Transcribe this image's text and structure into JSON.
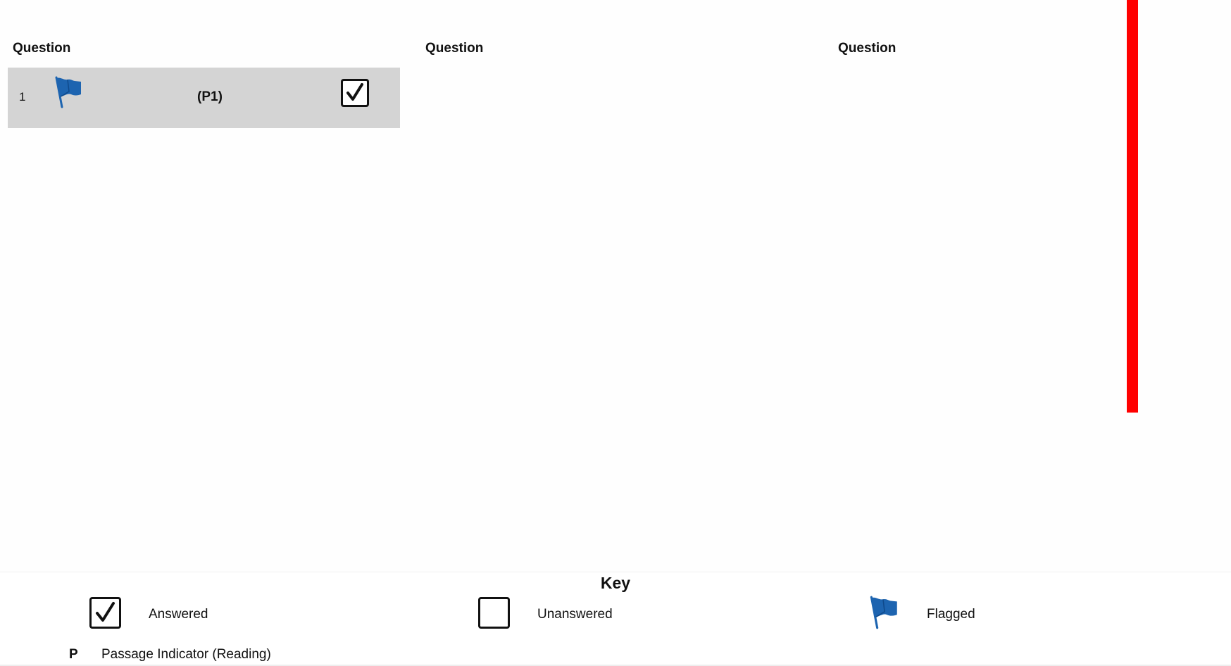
{
  "columns": {
    "header_1": "Question",
    "header_2": "Question",
    "header_3": "Question"
  },
  "questions": [
    {
      "number": "1",
      "passage": "(P1)",
      "flagged": true,
      "answered": true
    }
  ],
  "key": {
    "title": "Key",
    "answered_label": "Answered",
    "unanswered_label": "Unanswered",
    "flagged_label": "Flagged",
    "passage_letter": "P",
    "passage_label": "Passage Indicator (Reading)"
  },
  "colors": {
    "flag": "#1d64b0",
    "row_background": "#d4d4d4",
    "side_bar": "#ff0000"
  },
  "icons": {
    "flag": "flag-icon",
    "answered": "checkmark-icon",
    "unanswered": "empty-checkbox-icon"
  }
}
